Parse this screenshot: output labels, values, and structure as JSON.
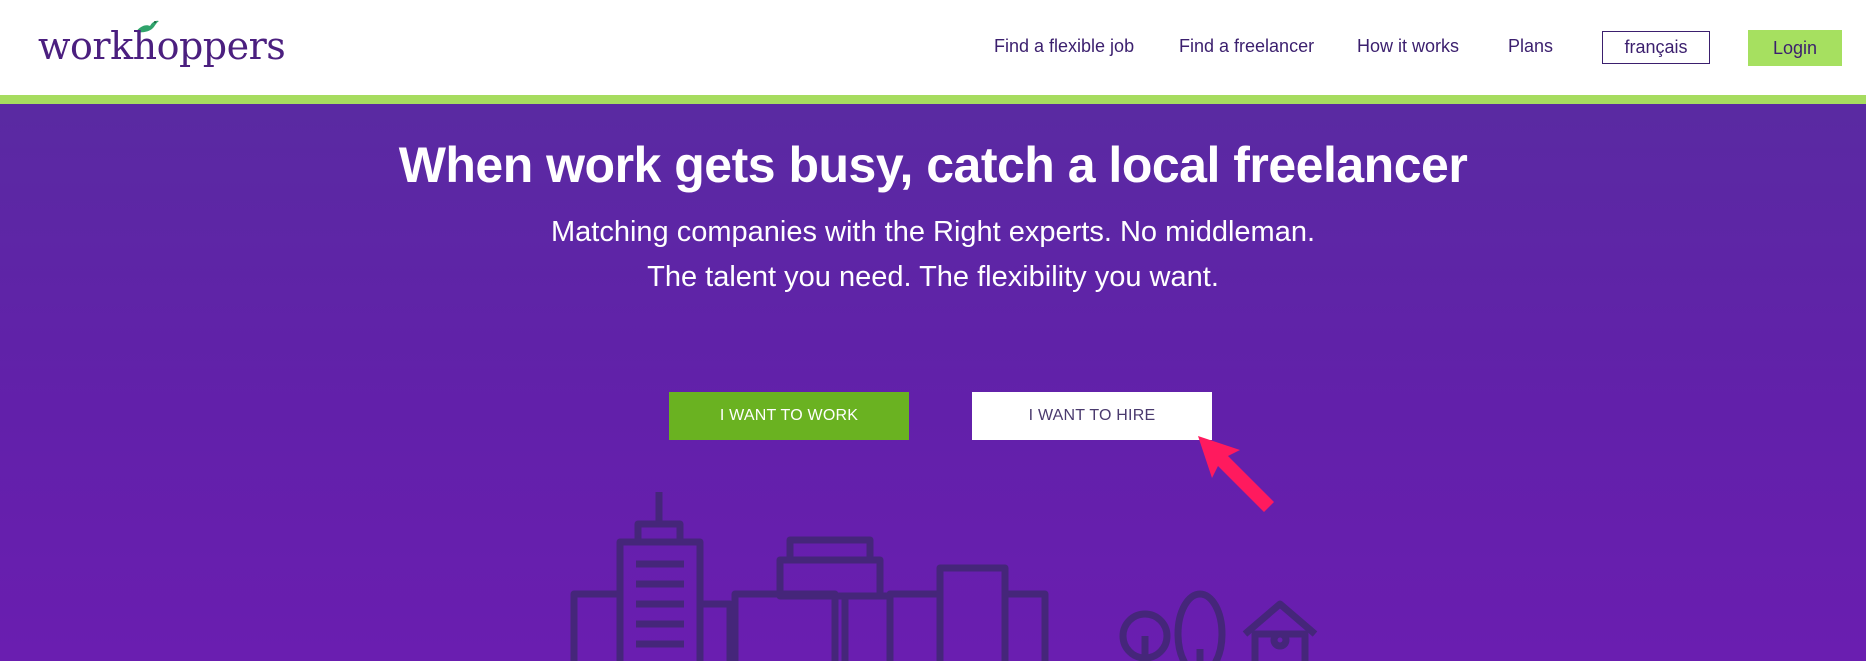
{
  "header": {
    "logo_text": "workhoppers",
    "nav": [
      {
        "label": "Find a flexible job"
      },
      {
        "label": "Find a freelancer"
      },
      {
        "label": "How it works"
      },
      {
        "label": "Plans"
      }
    ],
    "language_button": "français",
    "login_button": "Login"
  },
  "hero": {
    "title": "When work gets busy, catch a local freelancer",
    "subtitle_line1": "Matching companies with the Right experts. No middleman.",
    "subtitle_line2": "The talent you need. The flexibility you want.",
    "cta_work": "I WANT TO WORK",
    "cta_hire": "I WANT TO HIRE"
  },
  "icons": {
    "logo_bird": "bird-icon",
    "pointer": "arrow-pointer-icon",
    "illustration": "city-skyline-icon"
  },
  "colors": {
    "brand_purple": "#4b1f7f",
    "hero_top": "#5a2aa2",
    "hero_bottom": "#6a1eb0",
    "accent_green": "#a6dc5f",
    "cta_green": "#6ab221",
    "pointer_pink": "#ff1a5e"
  }
}
